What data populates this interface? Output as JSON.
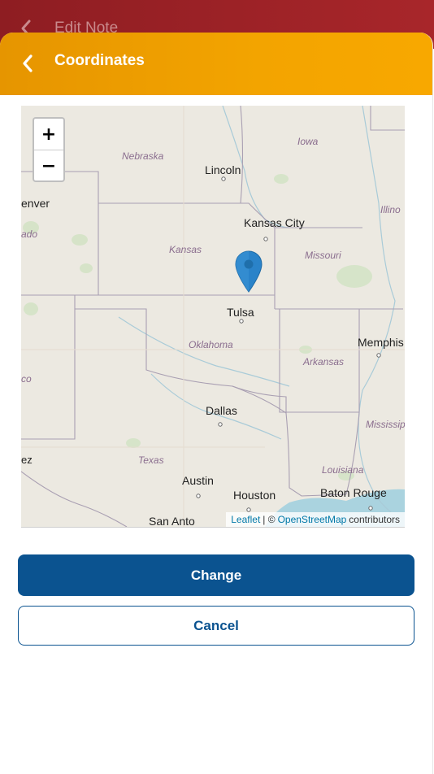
{
  "background_screen": {
    "title": "Edit Note",
    "back_icon": "chevron-left-icon"
  },
  "modal": {
    "title": "Coordinates",
    "back_icon": "chevron-left-icon",
    "header_color": "#f3a400"
  },
  "map": {
    "zoom_in_label": "+",
    "zoom_out_label": "−",
    "marker_icon": "map-pin-icon",
    "marker_color": "#2a83c9",
    "cities": {
      "lincoln": "Lincoln",
      "kansas_city": "Kansas City",
      "tulsa": "Tulsa",
      "memphis": "Memphis",
      "dallas": "Dallas",
      "austin": "Austin",
      "houston": "Houston",
      "baton_rouge": "Baton Rouge",
      "san_antonio": "San Anto",
      "denver": "enver",
      "edge_co": "ado",
      "edge_nm": "co",
      "edge_ez": "ez"
    },
    "states": {
      "nebraska": "Nebraska",
      "iowa": "Iowa",
      "illinois": "Illino",
      "kansas": "Kansas",
      "missouri": "Missouri",
      "oklahoma": "Oklahoma",
      "arkansas": "Arkansas",
      "mississippi": "Mississip",
      "texas": "Texas",
      "louisiana": "Louisiana"
    },
    "attribution": {
      "leaflet": "Leaflet",
      "separator": "| ©",
      "osm": "OpenStreetMap",
      "contributors": "contributors"
    }
  },
  "actions": {
    "change_label": "Change",
    "cancel_label": "Cancel",
    "primary_color": "#0b5390"
  }
}
